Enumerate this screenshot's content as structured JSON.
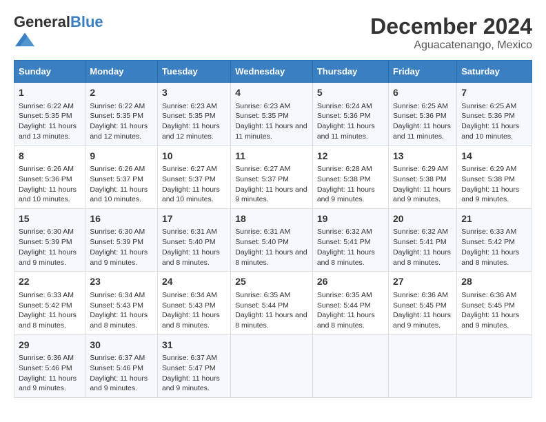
{
  "header": {
    "logo_general": "General",
    "logo_blue": "Blue",
    "title": "December 2024",
    "subtitle": "Aguacatenango, Mexico"
  },
  "days_of_week": [
    "Sunday",
    "Monday",
    "Tuesday",
    "Wednesday",
    "Thursday",
    "Friday",
    "Saturday"
  ],
  "weeks": [
    [
      {
        "day": "1",
        "sunrise": "Sunrise: 6:22 AM",
        "sunset": "Sunset: 5:35 PM",
        "daylight": "Daylight: 11 hours and 13 minutes."
      },
      {
        "day": "2",
        "sunrise": "Sunrise: 6:22 AM",
        "sunset": "Sunset: 5:35 PM",
        "daylight": "Daylight: 11 hours and 12 minutes."
      },
      {
        "day": "3",
        "sunrise": "Sunrise: 6:23 AM",
        "sunset": "Sunset: 5:35 PM",
        "daylight": "Daylight: 11 hours and 12 minutes."
      },
      {
        "day": "4",
        "sunrise": "Sunrise: 6:23 AM",
        "sunset": "Sunset: 5:35 PM",
        "daylight": "Daylight: 11 hours and 11 minutes."
      },
      {
        "day": "5",
        "sunrise": "Sunrise: 6:24 AM",
        "sunset": "Sunset: 5:36 PM",
        "daylight": "Daylight: 11 hours and 11 minutes."
      },
      {
        "day": "6",
        "sunrise": "Sunrise: 6:25 AM",
        "sunset": "Sunset: 5:36 PM",
        "daylight": "Daylight: 11 hours and 11 minutes."
      },
      {
        "day": "7",
        "sunrise": "Sunrise: 6:25 AM",
        "sunset": "Sunset: 5:36 PM",
        "daylight": "Daylight: 11 hours and 10 minutes."
      }
    ],
    [
      {
        "day": "8",
        "sunrise": "Sunrise: 6:26 AM",
        "sunset": "Sunset: 5:36 PM",
        "daylight": "Daylight: 11 hours and 10 minutes."
      },
      {
        "day": "9",
        "sunrise": "Sunrise: 6:26 AM",
        "sunset": "Sunset: 5:37 PM",
        "daylight": "Daylight: 11 hours and 10 minutes."
      },
      {
        "day": "10",
        "sunrise": "Sunrise: 6:27 AM",
        "sunset": "Sunset: 5:37 PM",
        "daylight": "Daylight: 11 hours and 10 minutes."
      },
      {
        "day": "11",
        "sunrise": "Sunrise: 6:27 AM",
        "sunset": "Sunset: 5:37 PM",
        "daylight": "Daylight: 11 hours and 9 minutes."
      },
      {
        "day": "12",
        "sunrise": "Sunrise: 6:28 AM",
        "sunset": "Sunset: 5:38 PM",
        "daylight": "Daylight: 11 hours and 9 minutes."
      },
      {
        "day": "13",
        "sunrise": "Sunrise: 6:29 AM",
        "sunset": "Sunset: 5:38 PM",
        "daylight": "Daylight: 11 hours and 9 minutes."
      },
      {
        "day": "14",
        "sunrise": "Sunrise: 6:29 AM",
        "sunset": "Sunset: 5:38 PM",
        "daylight": "Daylight: 11 hours and 9 minutes."
      }
    ],
    [
      {
        "day": "15",
        "sunrise": "Sunrise: 6:30 AM",
        "sunset": "Sunset: 5:39 PM",
        "daylight": "Daylight: 11 hours and 9 minutes."
      },
      {
        "day": "16",
        "sunrise": "Sunrise: 6:30 AM",
        "sunset": "Sunset: 5:39 PM",
        "daylight": "Daylight: 11 hours and 9 minutes."
      },
      {
        "day": "17",
        "sunrise": "Sunrise: 6:31 AM",
        "sunset": "Sunset: 5:40 PM",
        "daylight": "Daylight: 11 hours and 8 minutes."
      },
      {
        "day": "18",
        "sunrise": "Sunrise: 6:31 AM",
        "sunset": "Sunset: 5:40 PM",
        "daylight": "Daylight: 11 hours and 8 minutes."
      },
      {
        "day": "19",
        "sunrise": "Sunrise: 6:32 AM",
        "sunset": "Sunset: 5:41 PM",
        "daylight": "Daylight: 11 hours and 8 minutes."
      },
      {
        "day": "20",
        "sunrise": "Sunrise: 6:32 AM",
        "sunset": "Sunset: 5:41 PM",
        "daylight": "Daylight: 11 hours and 8 minutes."
      },
      {
        "day": "21",
        "sunrise": "Sunrise: 6:33 AM",
        "sunset": "Sunset: 5:42 PM",
        "daylight": "Daylight: 11 hours and 8 minutes."
      }
    ],
    [
      {
        "day": "22",
        "sunrise": "Sunrise: 6:33 AM",
        "sunset": "Sunset: 5:42 PM",
        "daylight": "Daylight: 11 hours and 8 minutes."
      },
      {
        "day": "23",
        "sunrise": "Sunrise: 6:34 AM",
        "sunset": "Sunset: 5:43 PM",
        "daylight": "Daylight: 11 hours and 8 minutes."
      },
      {
        "day": "24",
        "sunrise": "Sunrise: 6:34 AM",
        "sunset": "Sunset: 5:43 PM",
        "daylight": "Daylight: 11 hours and 8 minutes."
      },
      {
        "day": "25",
        "sunrise": "Sunrise: 6:35 AM",
        "sunset": "Sunset: 5:44 PM",
        "daylight": "Daylight: 11 hours and 8 minutes."
      },
      {
        "day": "26",
        "sunrise": "Sunrise: 6:35 AM",
        "sunset": "Sunset: 5:44 PM",
        "daylight": "Daylight: 11 hours and 8 minutes."
      },
      {
        "day": "27",
        "sunrise": "Sunrise: 6:36 AM",
        "sunset": "Sunset: 5:45 PM",
        "daylight": "Daylight: 11 hours and 9 minutes."
      },
      {
        "day": "28",
        "sunrise": "Sunrise: 6:36 AM",
        "sunset": "Sunset: 5:45 PM",
        "daylight": "Daylight: 11 hours and 9 minutes."
      }
    ],
    [
      {
        "day": "29",
        "sunrise": "Sunrise: 6:36 AM",
        "sunset": "Sunset: 5:46 PM",
        "daylight": "Daylight: 11 hours and 9 minutes."
      },
      {
        "day": "30",
        "sunrise": "Sunrise: 6:37 AM",
        "sunset": "Sunset: 5:46 PM",
        "daylight": "Daylight: 11 hours and 9 minutes."
      },
      {
        "day": "31",
        "sunrise": "Sunrise: 6:37 AM",
        "sunset": "Sunset: 5:47 PM",
        "daylight": "Daylight: 11 hours and 9 minutes."
      },
      null,
      null,
      null,
      null
    ]
  ]
}
